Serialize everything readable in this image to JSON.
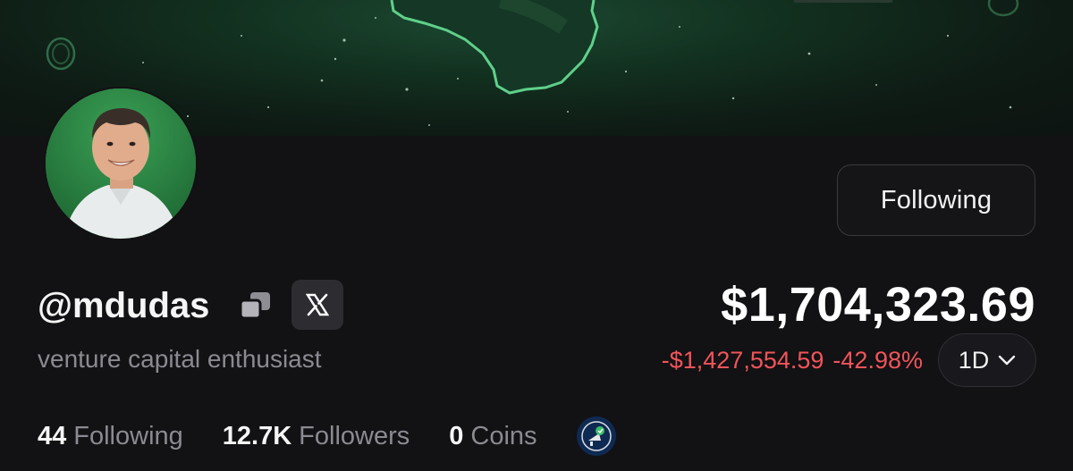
{
  "profile": {
    "handle": "@mdudas",
    "bio": "venture capital enthusiast",
    "follow_button_label": "Following"
  },
  "balance": {
    "value": "$1,704,323.69",
    "change_amount": "-$1,427,554.59",
    "change_percent": "-42.98%",
    "period": "1D"
  },
  "stats": [
    {
      "count": "44",
      "label": "Following"
    },
    {
      "count": "12.7K",
      "label": "Followers"
    },
    {
      "count": "0",
      "label": "Coins"
    }
  ],
  "colors": {
    "background": "#121114",
    "negative": "#f0555a",
    "muted_text": "#8c8a91",
    "banner_accent": "#5fd08a"
  },
  "icons": {
    "copy": "copy-icon",
    "x": "x-logo-icon",
    "period_chevron": "chevron-down-icon",
    "badge": "badge-icon"
  }
}
